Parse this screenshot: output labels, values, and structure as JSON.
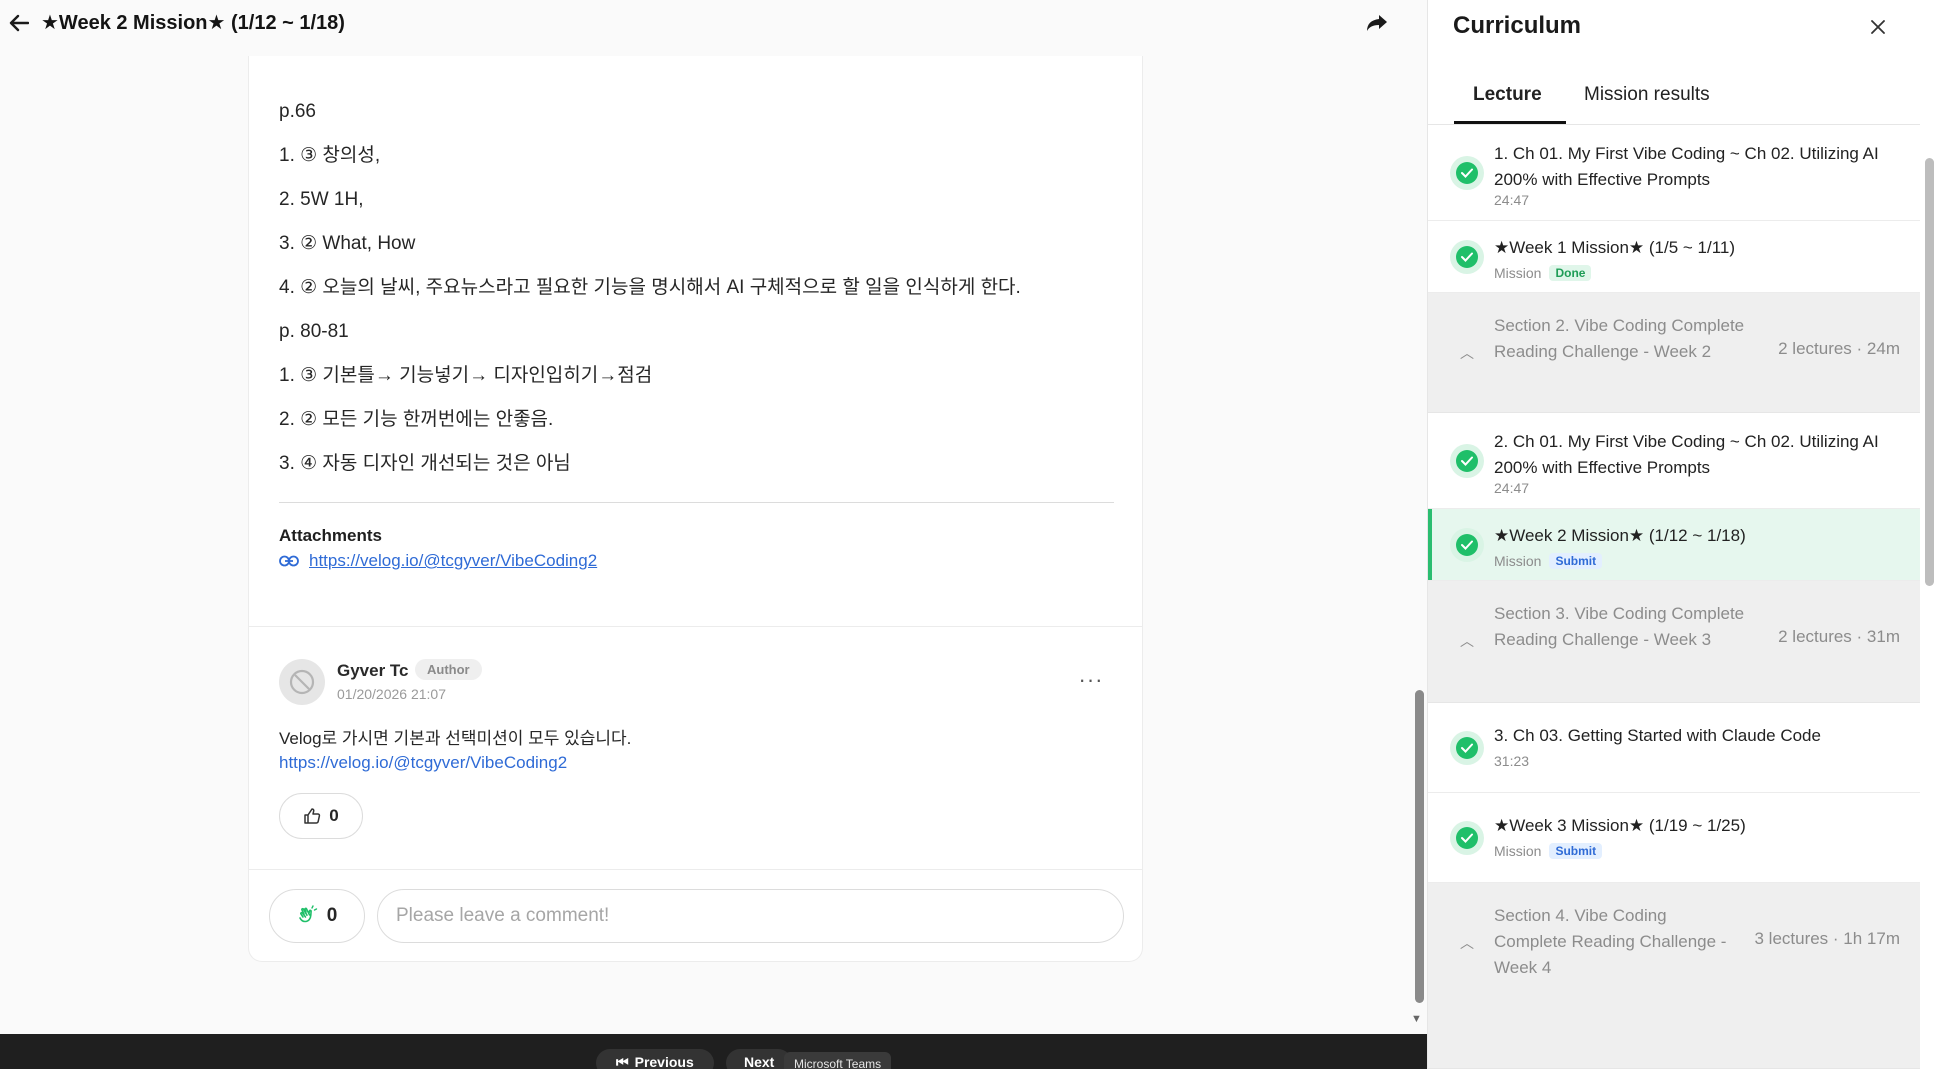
{
  "header": {
    "title": "★Week 2 Mission★ (1/12 ~ 1/18)"
  },
  "post": {
    "lines": [
      "p.66",
      "1. ③ 창의성,",
      "2. 5W 1H,",
      "3. ② What, How",
      "4. ② 오늘의 날씨, 주요뉴스라고 필요한 기능을 명시해서 AI 구체적으로 할 일을 인식하게 한다.",
      "p. 80-81",
      "1. ③ 기본틀→ 기능넣기→ 디자인입히기→점검",
      "2. ② 모든 기능 한꺼번에는 안좋음.",
      "3. ④ 자동 디자인 개선되는 것은 아님"
    ],
    "attachments_title": "Attachments",
    "attachment_url": "https://velog.io/@tcgyver/VibeCoding2"
  },
  "comment": {
    "author": "Gyver Tc",
    "badge": "Author",
    "date": "01/20/2026 21:07",
    "text": "Velog로 가시면 기본과 선택미션이 모두 있습니다.",
    "link": "https://velog.io/@tcgyver/VibeCoding2",
    "likes": "0",
    "more": "···"
  },
  "reply": {
    "claps": "0",
    "placeholder": "Please leave a comment!"
  },
  "taskbar": {
    "previous": "Previous",
    "next": "Next",
    "teams": "Microsoft Teams"
  },
  "curriculum": {
    "title": "Curriculum",
    "tabs": [
      "Lecture",
      "Mission results"
    ],
    "items": [
      {
        "kind": "lecture",
        "title": "1. Ch 01. My First Vibe Coding ~ Ch 02. Utilizing AI 200% with Effective Prompts",
        "meta": "24:47"
      },
      {
        "kind": "mission",
        "title": "★Week 1 Mission★ (1/5 ~ 1/11)",
        "meta": "Mission",
        "badge": "Done"
      },
      {
        "kind": "section",
        "title": "Section 2. Vibe Coding Complete Reading Challenge - Week 2",
        "count": "2 lectures · 24m"
      },
      {
        "kind": "lecture",
        "title": "2. Ch 01. My First Vibe Coding ~ Ch 02. Utilizing AI 200% with Effective Prompts",
        "meta": "24:47"
      },
      {
        "kind": "mission",
        "title": "★Week 2 Mission★ (1/12 ~ 1/18)",
        "meta": "Mission",
        "badge": "Submit"
      },
      {
        "kind": "section",
        "title": "Section 3. Vibe Coding Complete Reading Challenge - Week 3",
        "count": "2 lectures · 31m"
      },
      {
        "kind": "lecture",
        "title": "3. Ch 03. Getting Started with Claude Code",
        "meta": "31:23"
      },
      {
        "kind": "mission",
        "title": "★Week 3 Mission★ (1/19 ~ 1/25)",
        "meta": "Mission",
        "badge": "Submit"
      },
      {
        "kind": "section",
        "title": "Section 4. Vibe Coding Complete Reading Challenge - Week 4",
        "count": "3 lectures · 1h 17m"
      }
    ]
  },
  "colors": {
    "accent_green": "#1fbf69",
    "active_row": "#e6f7ee",
    "link_blue": "#2f6bd6"
  },
  "icons": [
    "back-arrow-icon",
    "share-icon",
    "link-icon",
    "avatar-icon",
    "thumbs-up-icon",
    "clap-icon",
    "close-icon",
    "check-icon",
    "chevron-up-icon"
  ]
}
